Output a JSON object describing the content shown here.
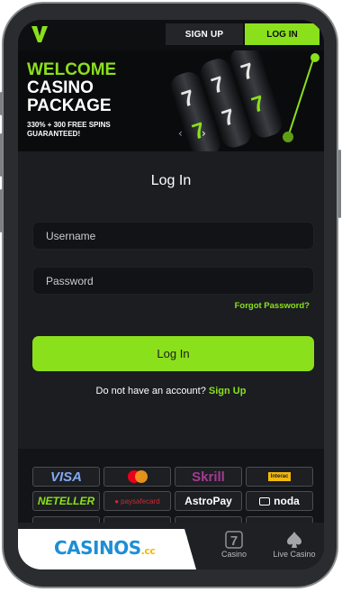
{
  "header": {
    "logo_letter": "V",
    "signup_label": "SIGN UP",
    "login_label": "LOG IN"
  },
  "banner": {
    "line1": "WELCOME",
    "line2": "CASINO",
    "line3": "PACKAGE",
    "sub1": "330% + 300 FREE SPINS",
    "sub2": "GUARANTEED!"
  },
  "login": {
    "title": "Log In",
    "username_placeholder": "Username",
    "password_placeholder": "Password",
    "forgot_label": "Forgot Password?",
    "submit_label": "Log In",
    "no_account_text": "Do not have an account?",
    "signup_link": "Sign Up"
  },
  "payments": {
    "row1": [
      "VISA",
      "",
      "Skrill",
      "Interac"
    ],
    "row2": [
      "NETELLER",
      "paysafecard",
      "AstroPay",
      "noda"
    ]
  },
  "bottom_nav": {
    "brand": "CASINOS",
    "brand_suffix": ".cc",
    "items": [
      {
        "label": "Casino",
        "icon": "seven-icon"
      },
      {
        "label": "Live Casino",
        "icon": "spade-icon"
      }
    ]
  },
  "colors": {
    "accent": "#8be01c",
    "background": "#1b1d21",
    "topbar": "#0e0f11"
  }
}
